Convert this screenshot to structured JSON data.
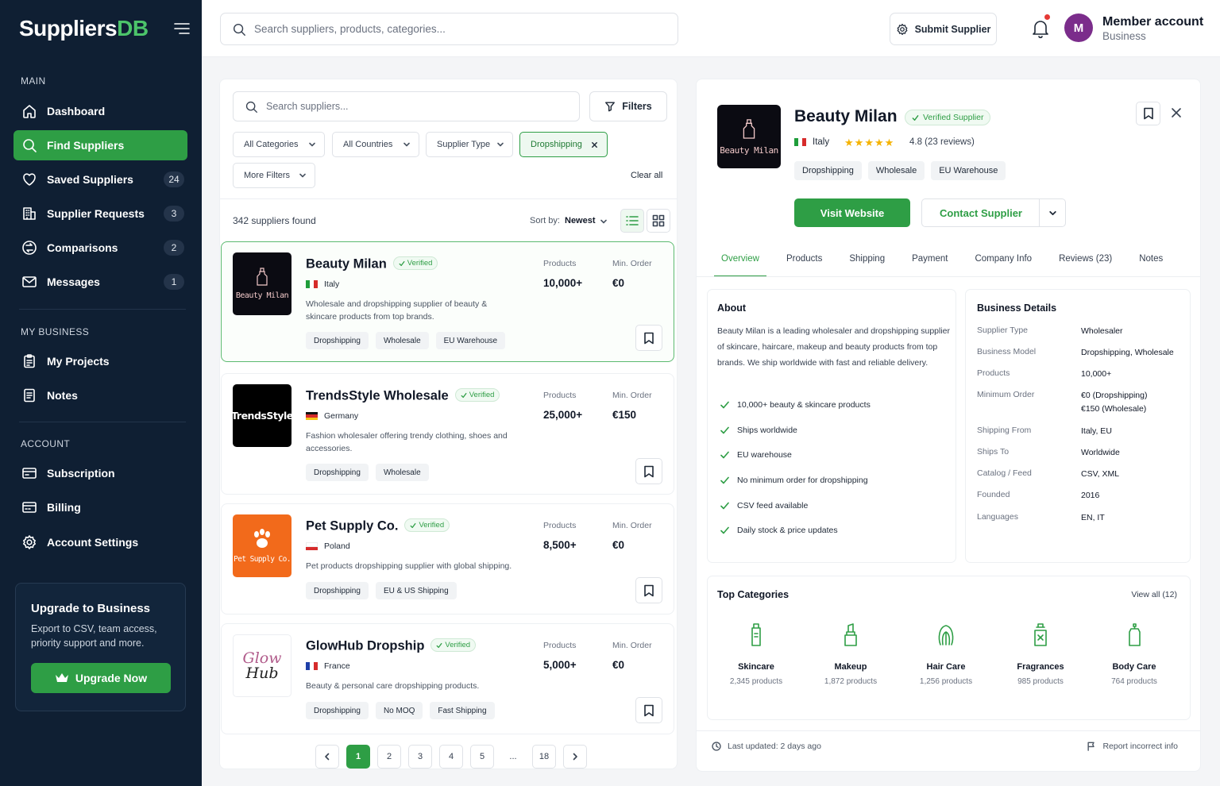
{
  "app": {
    "logo_main": "Suppliers",
    "logo_accent": "DB"
  },
  "sidebar": {
    "sections": {
      "main": "MAIN",
      "my_business": "MY BUSINESS",
      "account": "ACCOUNT"
    },
    "items": [
      {
        "label": "Dashboard",
        "icon": "home-icon"
      },
      {
        "label": "Find Suppliers",
        "icon": "search-icon",
        "active": true
      },
      {
        "label": "Saved Suppliers",
        "icon": "heart-icon",
        "count": "24"
      },
      {
        "label": "Supplier Requests",
        "icon": "building-icon",
        "count": "3"
      },
      {
        "label": "Comparisons",
        "icon": "compare-icon",
        "count": "2"
      },
      {
        "label": "Messages",
        "icon": "mail-icon",
        "count": "1"
      },
      {
        "label": "My Projects",
        "icon": "clipboard-icon"
      },
      {
        "label": "Notes",
        "icon": "notes-icon"
      },
      {
        "label": "Subscription",
        "icon": "card-icon"
      },
      {
        "label": "Billing",
        "icon": "billing-icon"
      },
      {
        "label": "Account Settings",
        "icon": "gear-icon"
      }
    ],
    "upgrade": {
      "title": "Upgrade to Business",
      "description": "Export to CSV, team access, priority support and more.",
      "button": "Upgrade Now"
    }
  },
  "topbar": {
    "search_placeholder": "Search suppliers, products, categories...",
    "submit_label": "Submit Supplier",
    "avatar_initial": "M",
    "account_name": "Member account",
    "account_plan": "Business"
  },
  "list": {
    "search_placeholder": "Search suppliers...",
    "filters_label": "Filters",
    "dropdowns": [
      "All Categories",
      "All Countries",
      "Supplier Type",
      "More Filters"
    ],
    "active_chip": "Dropshipping",
    "clear_all": "Clear all",
    "result_count": "342 suppliers found",
    "sort_label": "Sort by:",
    "sort_value": "Newest",
    "products_label": "Products",
    "min_order_label": "Min. Order",
    "verified_label": "Verified",
    "suppliers": [
      {
        "name": "Beauty Milan",
        "logo_text": "Beauty Milan",
        "country": "Italy",
        "description": "Wholesale and dropshipping supplier of beauty & skincare products from top brands.",
        "products": "10,000+",
        "min_order": "€0",
        "tags": [
          "Dropshipping",
          "Wholesale",
          "EU Warehouse"
        ]
      },
      {
        "name": "TrendsStyle Wholesale",
        "logo_text": "TrendsStyle",
        "country": "Germany",
        "description": "Fashion wholesaler offering trendy clothing, shoes and accessories.",
        "products": "25,000+",
        "min_order": "€150",
        "tags": [
          "Dropshipping",
          "Wholesale"
        ]
      },
      {
        "name": "Pet Supply Co.",
        "logo_text": "Pet Supply Co.",
        "country": "Poland",
        "description": "Pet products dropshipping supplier with global shipping.",
        "products": "8,500+",
        "min_order": "€0",
        "tags": [
          "Dropshipping",
          "EU & US Shipping"
        ]
      },
      {
        "name": "GlowHub Dropship",
        "logo_text_1": "Glow",
        "logo_text_2": "Hub",
        "country": "France",
        "description": "Beauty & personal care dropshipping products.",
        "products": "5,000+",
        "min_order": "€0",
        "tags": [
          "Dropshipping",
          "No MOQ",
          "Fast Shipping"
        ]
      }
    ],
    "pagination": [
      "1",
      "2",
      "3",
      "4",
      "5",
      "...",
      "18"
    ]
  },
  "detail": {
    "name": "Beauty Milan",
    "logo_text": "Beauty Milan",
    "verified_label": "Verified Supplier",
    "country": "Italy",
    "rating": 4.8,
    "rating_text": "4.8 (23 reviews)",
    "tags": [
      "Dropshipping",
      "Wholesale",
      "EU Warehouse"
    ],
    "visit_label": "Visit Website",
    "contact_label": "Contact Supplier",
    "tabs": [
      "Overview",
      "Products",
      "Shipping",
      "Payment",
      "Company Info",
      "Reviews (23)",
      "Notes"
    ],
    "about_title": "About",
    "about_text": "Beauty Milan is a leading wholesaler and dropshipping supplier of skincare, haircare, makeup and beauty products from top brands. We ship worldwide with fast and reliable delivery.",
    "features": [
      "10,000+ beauty & skincare products",
      "Ships worldwide",
      "EU warehouse",
      "No minimum order for dropshipping",
      "CSV feed available",
      "Daily stock & price updates"
    ],
    "business_title": "Business Details",
    "business": [
      {
        "k": "Supplier Type",
        "v": "Wholesaler"
      },
      {
        "k": "Business Model",
        "v": "Dropshipping, Wholesale"
      },
      {
        "k": "Products",
        "v": "10,000+"
      },
      {
        "k": "Minimum Order",
        "v": "€0 (Dropshipping)",
        "v2": "€150 (Wholesale)"
      },
      {
        "k": "Shipping From",
        "v": "Italy, EU"
      },
      {
        "k": "Ships To",
        "v": "Worldwide"
      },
      {
        "k": "Catalog / Feed",
        "v": "CSV, XML"
      },
      {
        "k": "Founded",
        "v": "2016"
      },
      {
        "k": "Languages",
        "v": "EN, IT"
      }
    ],
    "categories_title": "Top Categories",
    "view_all": "View all (12)",
    "categories": [
      {
        "name": "Skincare",
        "count": "2,345 products",
        "icon": "skincare-bottle-icon"
      },
      {
        "name": "Makeup",
        "count": "1,872 products",
        "icon": "lipstick-icon"
      },
      {
        "name": "Hair Care",
        "count": "1,256 products",
        "icon": "hair-icon"
      },
      {
        "name": "Fragrances",
        "count": "985 products",
        "icon": "perfume-icon"
      },
      {
        "name": "Body Care",
        "count": "764 products",
        "icon": "lotion-icon"
      }
    ],
    "last_updated": "Last updated: 2 days ago",
    "report": "Report incorrect info"
  },
  "colors": {
    "accent": "#2e9e45",
    "sidebar_bg": "#0f1f33",
    "notification_dot": "#e53935"
  }
}
